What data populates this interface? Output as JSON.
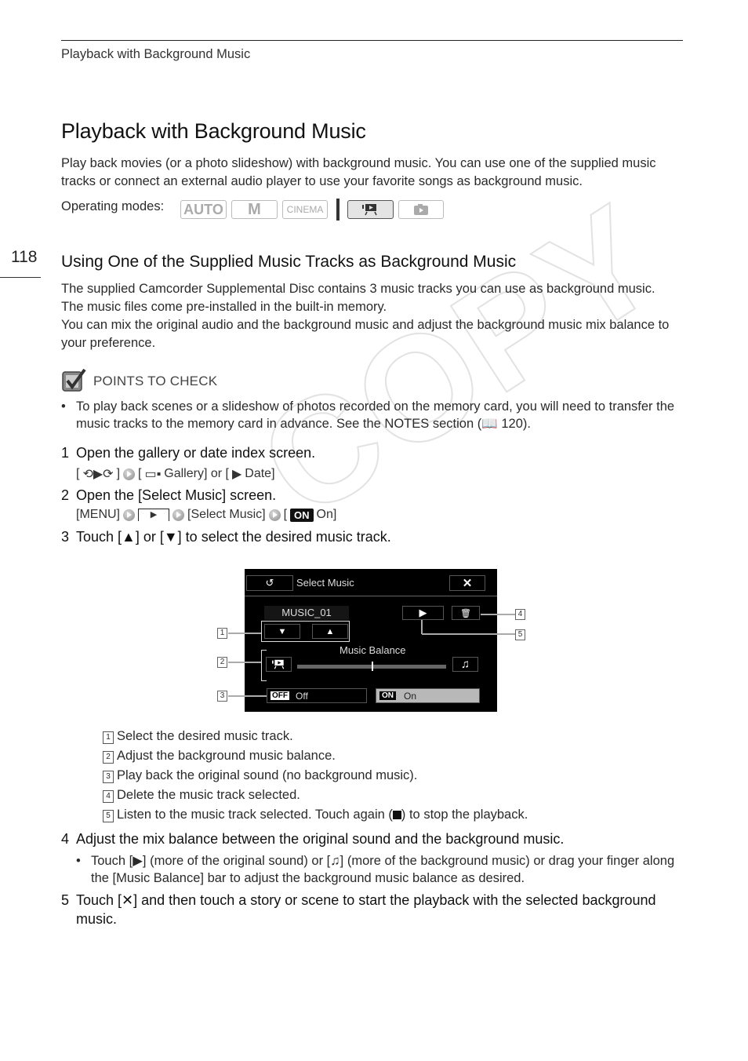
{
  "header": {
    "running_head": "Playback with Background Music",
    "page_number": "118"
  },
  "title": "Playback with Background Music",
  "intro": "Play back movies (or a photo slideshow) with background music. You can use one of the supplied music tracks or connect an external audio player to use your favorite songs as background music.",
  "operating_modes": {
    "label": "Operating modes:",
    "modes": [
      {
        "label": "AUTO",
        "active": false
      },
      {
        "label": "M",
        "active": false
      },
      {
        "label": "CINEMA",
        "active": false
      },
      {
        "label": "movie-playback",
        "active": true
      },
      {
        "label": "photo-playback",
        "active": false
      }
    ]
  },
  "section": {
    "title": "Using One of the Supplied Music Tracks as Background Music",
    "para1": "The supplied Camcorder Supplemental Disc contains 3 music tracks you can use as background music. The music files come pre-installed in the built-in memory.",
    "para2": "You can mix the original audio and the background music and adjust the background music mix balance to your preference."
  },
  "points_to_check": {
    "label": "POINTS TO CHECK",
    "bullet": "To play back scenes or a slideshow of photos recorded on the memory card, you will need to transfer the music tracks to the memory card in advance. See the NOTES section (",
    "bullet_ref": " 120)."
  },
  "steps": [
    {
      "num": "1",
      "text": "Open the gallery or date index screen.",
      "sub": [
        "[",
        "]",
        "[",
        " Gallery] or [",
        " Date]"
      ]
    },
    {
      "num": "2",
      "text": "Open the [Select Music] screen.",
      "sub": [
        "[MENU]",
        "[Select Music]",
        "[",
        "ON",
        " On]"
      ]
    },
    {
      "num": "3",
      "text": "Touch [▲] or [▼] to select the desired music track."
    },
    {
      "num": "4",
      "text": "Adjust the mix balance between the original sound and the background music."
    },
    {
      "num": "5",
      "text": "Touch [✕] and then touch a story or scene to start the playback with the selected background music."
    }
  ],
  "step4_bullet": "Touch [",
  "step4_bullet_mid": "] (more of the original sound) or [",
  "step4_bullet_end": "] (more of the background music) or drag your finger along the [Music Balance] bar to adjust the background music balance as desired.",
  "screen": {
    "title": "Select Music",
    "back_icon": "↺",
    "close_icon": "✕",
    "track": "MUSIC_01",
    "down": "▼",
    "up": "▲",
    "play": "▶",
    "delete_icon": "🗑",
    "balance_label": "Music Balance",
    "balance_value": 0.5,
    "music_icon": "♫",
    "off_badge": "OFF",
    "off_label": "Off",
    "on_badge": "ON",
    "on_label": "On"
  },
  "callouts": [
    "1",
    "2",
    "3",
    "4",
    "5"
  ],
  "legend": [
    "Select the desired music track.",
    "Adjust the background music balance.",
    "Play back the original sound (no background music).",
    "Delete the music track selected.",
    "Listen to the music track selected. Touch again ("
  ],
  "legend5_end": ") to stop the playback.",
  "watermark": "COPY"
}
